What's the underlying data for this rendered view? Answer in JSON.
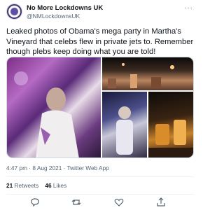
{
  "account": {
    "display_name": "No More Lockdowns UK",
    "handle": "@NMLockdownsUK"
  },
  "menu": {
    "more_icon": "more-options-icon",
    "more_glyph": "···"
  },
  "tweet": {
    "text": "Leaked photos of Obama's mega party in Martha's Vineyard that celebs flew in private jets to. Remember though plebs keep doing what you are told!",
    "images": [
      {
        "id": "photo-1",
        "desc": "party crowd with man in white outfit"
      },
      {
        "id": "photo-2",
        "desc": "outdoor night party with lights"
      },
      {
        "id": "photo-3",
        "desc": "crowd dancing"
      },
      {
        "id": "photo-4",
        "desc": "drinks bar close up"
      }
    ]
  },
  "meta": {
    "time": "4:47 pm",
    "date": "8 Aug 2021",
    "client": "Twitter Web App",
    "line": "4:47 pm · 8 Aug 2021 · Twitter Web App"
  },
  "stats": {
    "retweets_count": "21",
    "retweets_label": "Retweets",
    "likes_count": "46",
    "likes_label": "Likes"
  },
  "actions": [
    "reply-icon",
    "retweet-icon",
    "like-icon",
    "share-icon"
  ],
  "colors": {
    "text": "#0f1419",
    "secondary": "#536471",
    "border": "#cfd9de"
  }
}
